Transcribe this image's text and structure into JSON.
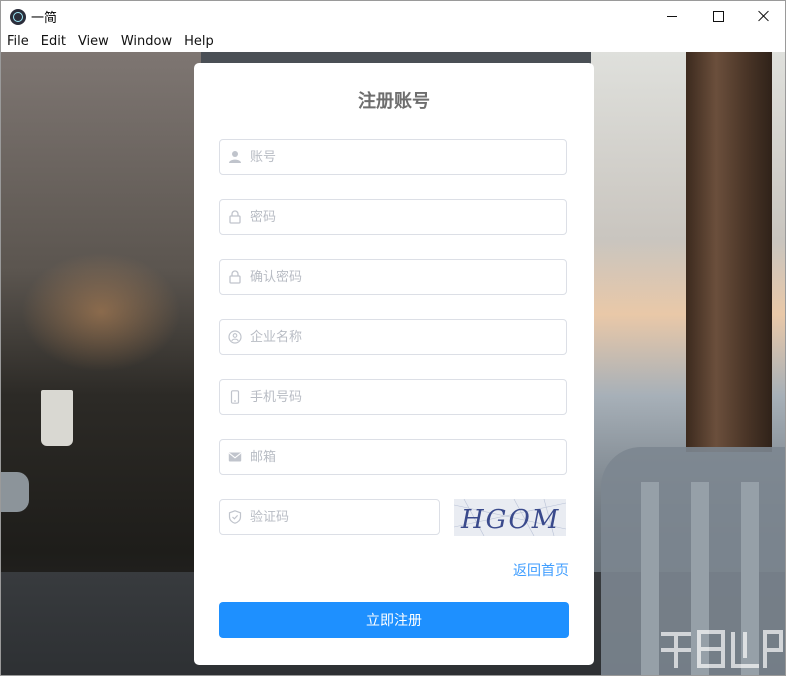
{
  "window": {
    "title": "一简"
  },
  "menu": {
    "items": [
      "File",
      "Edit",
      "View",
      "Window",
      "Help"
    ]
  },
  "form": {
    "title": "注册账号",
    "fields": [
      {
        "placeholder": "账号",
        "value": "",
        "icon": "user-icon"
      },
      {
        "placeholder": "密码",
        "value": "",
        "icon": "lock-icon"
      },
      {
        "placeholder": "确认密码",
        "value": "",
        "icon": "lock-icon"
      },
      {
        "placeholder": "企业名称",
        "value": "",
        "icon": "company-icon"
      },
      {
        "placeholder": "手机号码",
        "value": "",
        "icon": "phone-icon"
      },
      {
        "placeholder": "邮箱",
        "value": "",
        "icon": "mail-icon"
      }
    ],
    "captcha": {
      "placeholder": "验证码",
      "value": "",
      "icon": "shield-icon",
      "image_text": "HGOM"
    },
    "back_link": "返回首页",
    "submit_label": "立即注册"
  },
  "colors": {
    "accent": "#1e90ff",
    "link": "#409eff",
    "title": "#6e6e6e",
    "placeholder": "#b8bcc4"
  }
}
